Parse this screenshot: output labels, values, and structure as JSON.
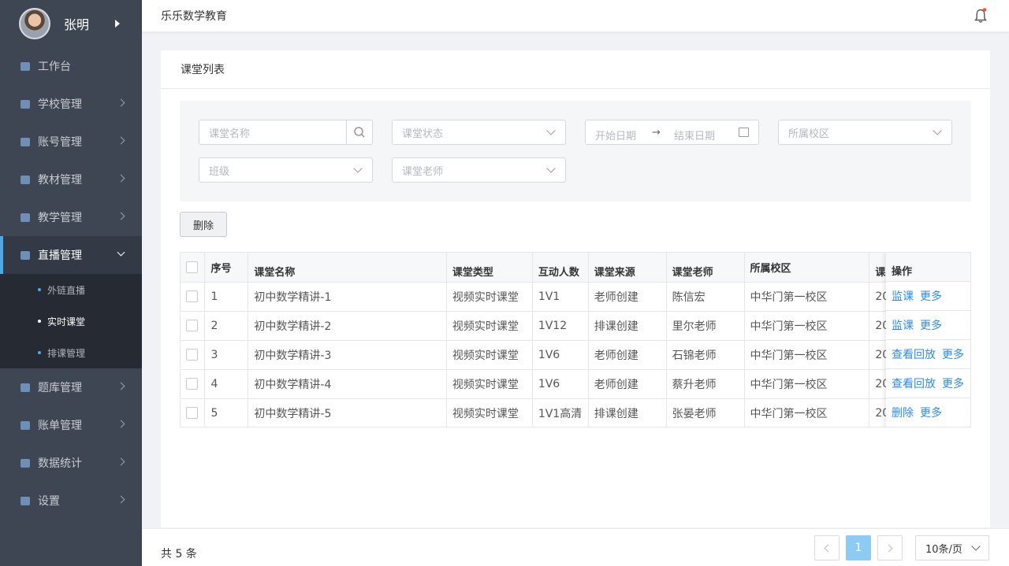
{
  "user": {
    "name": "张明"
  },
  "sidebar": {
    "items": [
      {
        "label": "工作台",
        "icon": "dashboard-icon",
        "has_children": false
      },
      {
        "label": "学校管理",
        "icon": "school-icon",
        "has_children": true
      },
      {
        "label": "账号管理",
        "icon": "account-icon",
        "has_children": true
      },
      {
        "label": "教材管理",
        "icon": "book-icon",
        "has_children": true
      },
      {
        "label": "教学管理",
        "icon": "teaching-icon",
        "has_children": true
      },
      {
        "label": "直播管理",
        "icon": "live-icon",
        "has_children": true,
        "expanded": true
      },
      {
        "label": "题库管理",
        "icon": "question-bank-icon",
        "has_children": true
      },
      {
        "label": "账单管理",
        "icon": "bill-icon",
        "has_children": true
      },
      {
        "label": "数据统计",
        "icon": "chart-icon",
        "has_children": true
      },
      {
        "label": "设置",
        "icon": "settings-icon",
        "has_children": true
      }
    ],
    "live_submenu": [
      {
        "label": "外链直播"
      },
      {
        "label": "实时课堂",
        "active": true
      },
      {
        "label": "排课管理"
      }
    ]
  },
  "header": {
    "title": "乐乐数学教育"
  },
  "card": {
    "title": "课堂列表"
  },
  "filters": {
    "class_name_placeholder": "课堂名称",
    "status_placeholder": "课堂状态",
    "start_date_placeholder": "开始日期",
    "end_date_placeholder": "结束日期",
    "campus_placeholder": "所属校区",
    "grade_placeholder": "班级",
    "teacher_placeholder": "课堂老师"
  },
  "toolbar": {
    "delete_label": "删除"
  },
  "table": {
    "columns": [
      "序号",
      "课堂名称",
      "课堂类型",
      "互动人数",
      "课堂来源",
      "课堂老师",
      "所属校区",
      "课",
      "操作"
    ],
    "rows": [
      {
        "index": "1",
        "name": "初中数学精讲-1",
        "type": "视频实时课堂",
        "count": "1V1",
        "source": "老师创建",
        "teacher": "陈信宏",
        "campus": "中华门第一校区",
        "time": "20",
        "actions": [
          "监课",
          "更多"
        ]
      },
      {
        "index": "2",
        "name": "初中数学精讲-2",
        "type": "视频实时课堂",
        "count": "1V12",
        "source": "排课创建",
        "teacher": "里尔老师",
        "campus": "中华门第一校区",
        "time": "20",
        "actions": [
          "监课",
          "更多"
        ]
      },
      {
        "index": "3",
        "name": "初中数学精讲-3",
        "type": "视频实时课堂",
        "count": "1V6",
        "source": "老师创建",
        "teacher": "石锦老师",
        "campus": "中华门第一校区",
        "time": "20",
        "actions": [
          "查看回放",
          "更多"
        ]
      },
      {
        "index": "4",
        "name": "初中数学精讲-4",
        "type": "视频实时课堂",
        "count": "1V6",
        "source": "老师创建",
        "teacher": "蔡升老师",
        "campus": "中华门第一校区",
        "time": "20",
        "actions": [
          "查看回放",
          "更多"
        ]
      },
      {
        "index": "5",
        "name": "初中数学精讲-5",
        "type": "视频实时课堂",
        "count": "1V1高清",
        "source": "排课创建",
        "teacher": "张晏老师",
        "campus": "中华门第一校区",
        "time": "20",
        "actions": [
          "删除",
          "更多"
        ]
      }
    ]
  },
  "pagination": {
    "total_text": "共 5 条",
    "current_page": "1",
    "page_size": "10条/页"
  },
  "colors": {
    "sidebar_bg": "#3f4653",
    "accent": "#4ea8e8",
    "link": "#2d8cf0",
    "page_active": "#8ecbf2"
  }
}
